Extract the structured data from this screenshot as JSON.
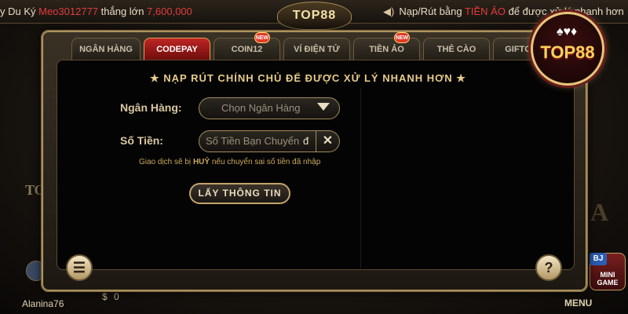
{
  "ticker": {
    "prefix": "y Du Ký ",
    "user": "Meo3012777",
    "middle": " thắng lớn ",
    "amount": "7,600,000"
  },
  "notice": {
    "speaker_icon": "speaker-icon",
    "text_before": "Nạp/Rút bằng ",
    "highlight": "TIỀN ẢO",
    "text_after": " để được xử lý nhanh hơn"
  },
  "brand": {
    "top_logo": "TOP88",
    "big_logo": "TOP88"
  },
  "tabs": [
    {
      "label": "NGÂN HÀNG",
      "active": false,
      "new": false
    },
    {
      "label": "CODEPAY",
      "active": true,
      "new": false
    },
    {
      "label": "COIN12",
      "active": false,
      "new": true
    },
    {
      "label": "VÍ ĐIỆN TỬ",
      "active": false,
      "new": false
    },
    {
      "label": "TIỀN ẢO",
      "active": false,
      "new": true
    },
    {
      "label": "THẺ CÀO",
      "active": false,
      "new": false
    },
    {
      "label": "GIFTCO",
      "active": false,
      "new": false
    }
  ],
  "new_badge_text": "NEW",
  "dialog": {
    "title": "NẠP RÚT CHÍNH CHỦ ĐỂ ĐƯỢC XỬ LÝ NHANH HƠN",
    "star": "★",
    "bank_label": "Ngân Hàng:",
    "bank_placeholder": "Chọn Ngân Hàng",
    "amount_label": "Số Tiền:",
    "amount_placeholder": "Số Tiền Bạn Chuyển",
    "currency": "đ",
    "clear_symbol": "✕",
    "hint_before": "Giao dịch sẽ bị ",
    "hint_bold": "HUỶ",
    "hint_after": " nếu chuyển sai số tiền đã nhập",
    "fetch_button": "LẤY THÔNG TIN",
    "notes_symbol": "☰",
    "help_symbol": "?"
  },
  "background": {
    "user_name": "Alanina76",
    "balance": "0",
    "balance_icon": "$",
    "menu_label": "MENU",
    "mini_game": "MINI GAME",
    "mini_badge": "BJ"
  },
  "colors": {
    "accent_gold": "#e7cd8a",
    "active_tab": "#c02525",
    "highlight_red": "#e23b3b"
  }
}
